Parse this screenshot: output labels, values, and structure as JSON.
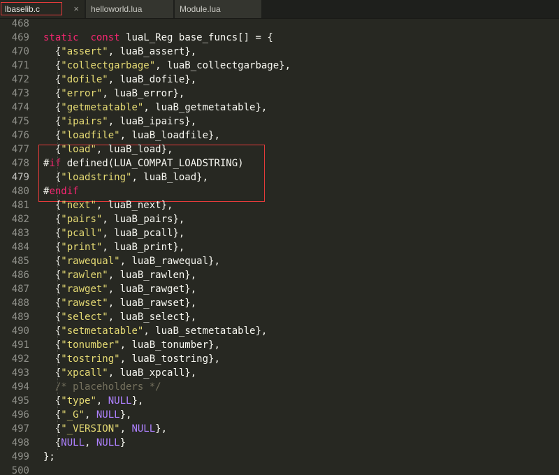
{
  "tabs": [
    {
      "label": "lbaselib.c",
      "close": "×",
      "active": true
    },
    {
      "label": "helloworld.lua",
      "active": false
    },
    {
      "label": "Module.lua",
      "active": false
    }
  ],
  "editor": {
    "lines": [
      {
        "n": "468",
        "parts": []
      },
      {
        "n": "469",
        "parts": [
          [
            "kw",
            "static"
          ],
          [
            "",
            "  "
          ],
          [
            "kw",
            "const"
          ],
          [
            "",
            "",
            " "
          ],
          [
            "",
            "luaL_Reg base_funcs[] = {"
          ]
        ]
      },
      {
        "n": "470",
        "parts": [
          [
            "",
            "  {"
          ],
          [
            "str",
            "\"assert\""
          ],
          [
            "",
            ", luaB_assert},"
          ]
        ]
      },
      {
        "n": "471",
        "parts": [
          [
            "",
            "  {"
          ],
          [
            "str",
            "\"collectgarbage\""
          ],
          [
            "",
            ", luaB_collectgarbage},"
          ]
        ]
      },
      {
        "n": "472",
        "parts": [
          [
            "",
            "  {"
          ],
          [
            "str",
            "\"dofile\""
          ],
          [
            "",
            ", luaB_dofile},"
          ]
        ]
      },
      {
        "n": "473",
        "parts": [
          [
            "",
            "  {"
          ],
          [
            "str",
            "\"error\""
          ],
          [
            "",
            ", luaB_error},"
          ]
        ]
      },
      {
        "n": "474",
        "parts": [
          [
            "",
            "  {"
          ],
          [
            "str",
            "\"getmetatable\""
          ],
          [
            "",
            ", luaB_getmetatable},"
          ]
        ]
      },
      {
        "n": "475",
        "parts": [
          [
            "",
            "  {"
          ],
          [
            "str",
            "\"ipairs\""
          ],
          [
            "",
            ", luaB_ipairs},"
          ]
        ]
      },
      {
        "n": "476",
        "parts": [
          [
            "",
            "  {"
          ],
          [
            "str",
            "\"loadfile\""
          ],
          [
            "",
            ", luaB_loadfile},"
          ]
        ]
      },
      {
        "n": "477",
        "parts": [
          [
            "",
            "  {"
          ],
          [
            "str",
            "\"load\""
          ],
          [
            "",
            ", luaB_load},"
          ]
        ]
      },
      {
        "n": "478",
        "parts": [
          [
            "pp",
            "#"
          ],
          [
            "kw",
            "if"
          ],
          [
            "",
            "",
            " "
          ],
          [
            "",
            "defined(LUA_COMPAT_LOADSTRING)"
          ]
        ]
      },
      {
        "n": "479",
        "parts": [
          [
            "",
            "  {"
          ],
          [
            "str",
            "\"loadstring\""
          ],
          [
            "",
            ", luaB_load},"
          ]
        ],
        "current": true
      },
      {
        "n": "480",
        "parts": [
          [
            "pp",
            "#"
          ],
          [
            "kw",
            "endif"
          ]
        ]
      },
      {
        "n": "481",
        "parts": [
          [
            "",
            "  {"
          ],
          [
            "str",
            "\"next\""
          ],
          [
            "",
            ", luaB_next},"
          ]
        ]
      },
      {
        "n": "482",
        "parts": [
          [
            "",
            "  {"
          ],
          [
            "str",
            "\"pairs\""
          ],
          [
            "",
            ", luaB_pairs},"
          ]
        ]
      },
      {
        "n": "483",
        "parts": [
          [
            "",
            "  {"
          ],
          [
            "str",
            "\"pcall\""
          ],
          [
            "",
            ", luaB_pcall},"
          ]
        ]
      },
      {
        "n": "484",
        "parts": [
          [
            "",
            "  {"
          ],
          [
            "str",
            "\"print\""
          ],
          [
            "",
            ", luaB_print},"
          ]
        ]
      },
      {
        "n": "485",
        "parts": [
          [
            "",
            "  {"
          ],
          [
            "str",
            "\"rawequal\""
          ],
          [
            "",
            ", luaB_rawequal},"
          ]
        ]
      },
      {
        "n": "486",
        "parts": [
          [
            "",
            "  {"
          ],
          [
            "str",
            "\"rawlen\""
          ],
          [
            "",
            ", luaB_rawlen},"
          ]
        ]
      },
      {
        "n": "487",
        "parts": [
          [
            "",
            "  {"
          ],
          [
            "str",
            "\"rawget\""
          ],
          [
            "",
            ", luaB_rawget},"
          ]
        ]
      },
      {
        "n": "488",
        "parts": [
          [
            "",
            "  {"
          ],
          [
            "str",
            "\"rawset\""
          ],
          [
            "",
            ", luaB_rawset},"
          ]
        ]
      },
      {
        "n": "489",
        "parts": [
          [
            "",
            "  {"
          ],
          [
            "str",
            "\"select\""
          ],
          [
            "",
            ", luaB_select},"
          ]
        ]
      },
      {
        "n": "490",
        "parts": [
          [
            "",
            "  {"
          ],
          [
            "str",
            "\"setmetatable\""
          ],
          [
            "",
            ", luaB_setmetatable},"
          ]
        ]
      },
      {
        "n": "491",
        "parts": [
          [
            "",
            "  {"
          ],
          [
            "str",
            "\"tonumber\""
          ],
          [
            "",
            ", luaB_tonumber},"
          ]
        ]
      },
      {
        "n": "492",
        "parts": [
          [
            "",
            "  {"
          ],
          [
            "str",
            "\"tostring\""
          ],
          [
            "",
            ", luaB_tostring},"
          ]
        ]
      },
      {
        "n": "493",
        "parts": [
          [
            "",
            "  {"
          ],
          [
            "str",
            "\"xpcall\""
          ],
          [
            "",
            ", luaB_xpcall},"
          ]
        ]
      },
      {
        "n": "494",
        "parts": [
          [
            "",
            "  "
          ],
          [
            "cm",
            "/* placeholders */"
          ]
        ]
      },
      {
        "n": "495",
        "parts": [
          [
            "",
            "  {"
          ],
          [
            "str",
            "\"type\""
          ],
          [
            "",
            ", "
          ],
          [
            "num",
            "NULL"
          ],
          [
            "",
            "},"
          ]
        ]
      },
      {
        "n": "496",
        "parts": [
          [
            "",
            "  {"
          ],
          [
            "str",
            "\"_G\""
          ],
          [
            "",
            ", "
          ],
          [
            "num",
            "NULL"
          ],
          [
            "",
            "},"
          ]
        ]
      },
      {
        "n": "497",
        "parts": [
          [
            "",
            "  {"
          ],
          [
            "str",
            "\"_VERSION\""
          ],
          [
            "",
            ", "
          ],
          [
            "num",
            "NULL"
          ],
          [
            "",
            "},"
          ]
        ]
      },
      {
        "n": "498",
        "parts": [
          [
            "",
            "  {"
          ],
          [
            "num",
            "NULL"
          ],
          [
            "",
            ", "
          ],
          [
            "num",
            "NULL"
          ],
          [
            "",
            "}"
          ]
        ]
      },
      {
        "n": "499",
        "parts": [
          [
            "",
            "};"
          ]
        ]
      },
      {
        "n": "500",
        "parts": []
      }
    ]
  }
}
